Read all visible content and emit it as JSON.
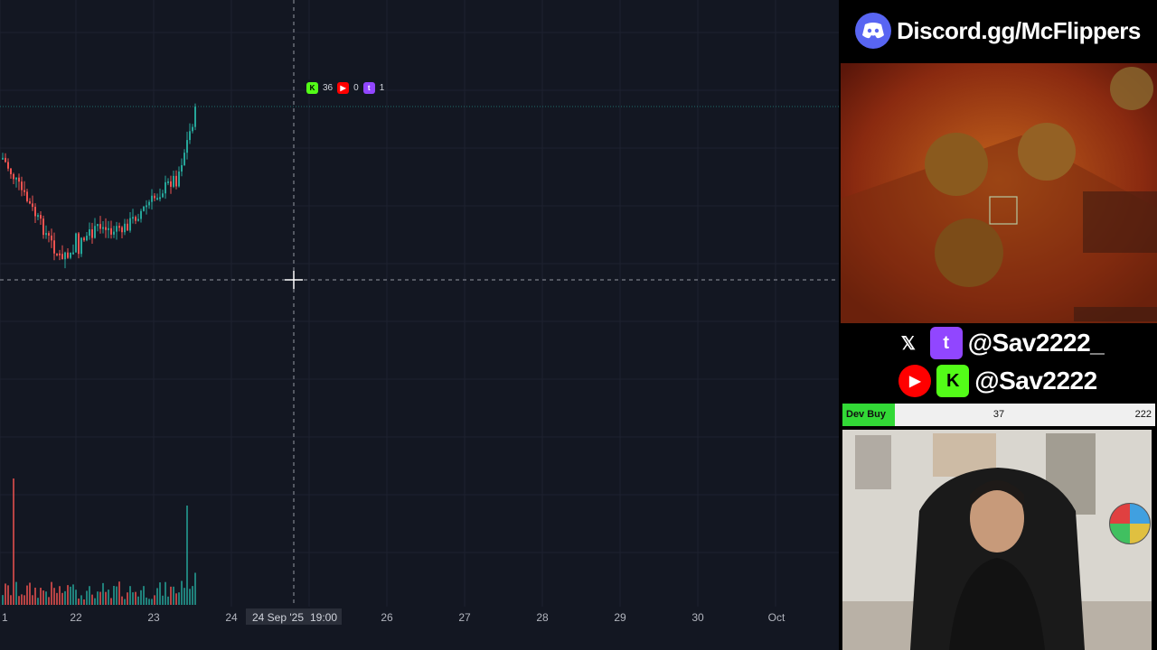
{
  "chart": {
    "x_ticks": [
      "1",
      "22",
      "23",
      "24",
      "26",
      "27",
      "28",
      "29",
      "30",
      "Oct"
    ],
    "crosshair_date": "24 Sep '25",
    "crosshair_time": "19:00",
    "stats": {
      "kick_count": "36",
      "youtube_count": "0",
      "twitch_count": "1"
    },
    "up_color": "#26a69a",
    "down_color": "#ef5350",
    "grid_color": "#1e2230"
  },
  "discord": {
    "text": "Discord.gg/McFlippers",
    "icon": "discord-icon"
  },
  "socials": {
    "row1": {
      "icons": [
        "x-icon",
        "twitch-icon"
      ],
      "handle": "@Sav2222_"
    },
    "row2": {
      "icons": [
        "youtube-icon",
        "kick-icon"
      ],
      "handle": "@Sav2222"
    }
  },
  "dev_buy": {
    "label": "Dev Buy",
    "current": "37",
    "max": "222",
    "progress": 0.167
  },
  "colors": {
    "discord": "#5865f2",
    "twitch": "#9146ff",
    "youtube": "#ff0000",
    "kick": "#53fc18"
  }
}
